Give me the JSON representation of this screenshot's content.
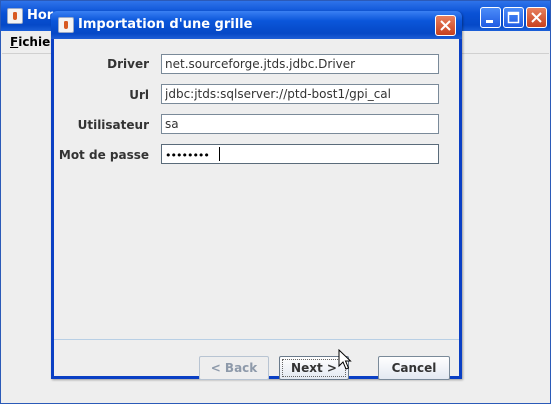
{
  "main_window": {
    "title": "Hora",
    "menu": {
      "file_label": "Fichier",
      "file_mnemonic": "F",
      "file_rest": "ichier"
    }
  },
  "dialog": {
    "title": "Importation d'une grille",
    "fields": {
      "driver": {
        "label": "Driver",
        "value": "net.sourceforge.jtds.jdbc.Driver"
      },
      "url": {
        "label": "Url",
        "value": "jdbc:jtds:sqlserver://ptd-bost1/gpi_cal"
      },
      "user": {
        "label": "Utilisateur",
        "value": "sa"
      },
      "password": {
        "label": "Mot de passe",
        "masked": "••••••••"
      }
    },
    "buttons": {
      "back": "< Back",
      "next": "Next >",
      "cancel": "Cancel"
    }
  },
  "colors": {
    "titlebar_blue": "#0A52D6",
    "close_red": "#C7401E",
    "panel_bg": "#EEEEEE"
  },
  "icons": [
    "java-app-icon",
    "minimize-icon",
    "maximize-icon",
    "close-icon",
    "mouse-cursor-icon"
  ]
}
